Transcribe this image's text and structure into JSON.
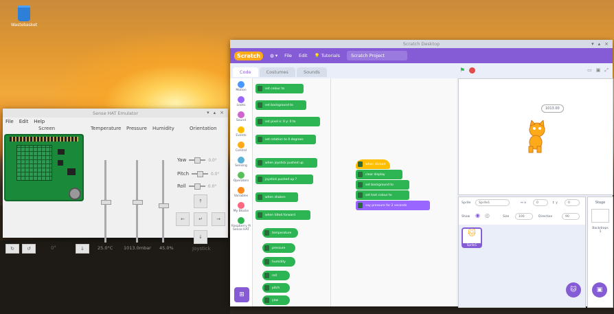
{
  "desktop": {
    "trash_label": "Wastebasket"
  },
  "sense_hat": {
    "title": "Sense HAT Emulator",
    "menu": [
      "File",
      "Edit",
      "Help"
    ],
    "columns": {
      "screen": "Screen",
      "temperature": "Temperature",
      "pressure": "Pressure",
      "humidity": "Humidity",
      "orientation": "Orientation"
    },
    "temperature_value": "25.0°C",
    "pressure_value": "1013.0mbar",
    "humidity_value": "45.0%",
    "temperature_level": 0.5,
    "pressure_level": 0.5,
    "humidity_level": 0.45,
    "orientation": [
      {
        "label": "Yaw",
        "value": "0.0°"
      },
      {
        "label": "Pitch",
        "value": "0.0°"
      },
      {
        "label": "Roll",
        "value": "0.0°"
      }
    ],
    "rotation_value": "0°",
    "joystick_label": "Joystick",
    "joystick": {
      "up": "↑",
      "down": "↓",
      "left": "←",
      "right": "→",
      "center": "↵"
    },
    "bottom_buttons": {
      "rotate_left": "↻",
      "rotate_right": "↺",
      "down": "↓"
    }
  },
  "scratch": {
    "title": "Scratch Desktop",
    "logo": "Scratch",
    "menu": {
      "file": "File",
      "edit": "Edit",
      "tutorials": "Tutorials"
    },
    "project_title": "Scratch Project",
    "tabs": [
      "Code",
      "Costumes",
      "Sounds"
    ],
    "categories": [
      {
        "label": "Motion",
        "color": "#4c97ff"
      },
      {
        "label": "Looks",
        "color": "#9966ff"
      },
      {
        "label": "Sound",
        "color": "#cf63cf"
      },
      {
        "label": "Events",
        "color": "#ffbf00"
      },
      {
        "label": "Control",
        "color": "#ffab19"
      },
      {
        "label": "Sensing",
        "color": "#5cb1d6"
      },
      {
        "label": "Operators",
        "color": "#59c059"
      },
      {
        "label": "Variables",
        "color": "#ff8c1a"
      },
      {
        "label": "My Blocks",
        "color": "#ff6680"
      },
      {
        "label": "Raspberry Pi Sense HAT",
        "color": "#2db553"
      }
    ],
    "palette_blocks": [
      "set colour to",
      "set background to",
      "set pixel x: 0 y: 0 to",
      "set rotation to 0 degrees",
      "when joystick pushed up",
      "joystick pushed up ?",
      "when shaken",
      "when tilted forward",
      "temperature",
      "pressure",
      "humidity",
      "roll",
      "pitch",
      "yaw"
    ],
    "script": {
      "hat": "when clicked",
      "blocks": [
        "clear display",
        "set background to",
        "set text colour to",
        "say pressure for 2 seconds"
      ],
      "say_value": "2"
    },
    "stage": {
      "bubble": "1013.00"
    },
    "sprite_info": {
      "sprite_label": "Sprite",
      "sprite_name": "Sprite1",
      "x_label": "↔ x",
      "x_value": "0",
      "y_label": "↕ y",
      "y_value": "0",
      "show_label": "Show",
      "size_label": "Size",
      "size_value": "100",
      "direction_label": "Direction",
      "direction_value": "90",
      "thumb_label": "Sprite1"
    },
    "stage_panel": {
      "title": "Stage",
      "backdrops_label": "Backdrops",
      "backdrops_count": "1"
    },
    "zoom": {
      "in": "+",
      "out": "−",
      "reset": "="
    }
  }
}
